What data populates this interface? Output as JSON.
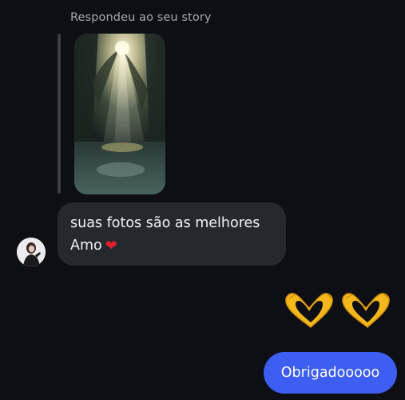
{
  "reply_context": {
    "caption": "Respondeu ao seu story"
  },
  "incoming_message": {
    "line1": "suas fotos são as melhores",
    "line2": "Amo",
    "emoji": "heart"
  },
  "reaction_emojis": [
    "heart-hands",
    "heart-hands"
  ],
  "outgoing_message": {
    "text": "Obrigadooooo"
  },
  "colors": {
    "background": "#0d0f14",
    "incoming_bubble": "#262830",
    "outgoing_bubble": "#3d5ef0",
    "caption_text": "#a3a8b2",
    "heart": "#e0202e",
    "emoji_yellow": "#f5b81c"
  }
}
